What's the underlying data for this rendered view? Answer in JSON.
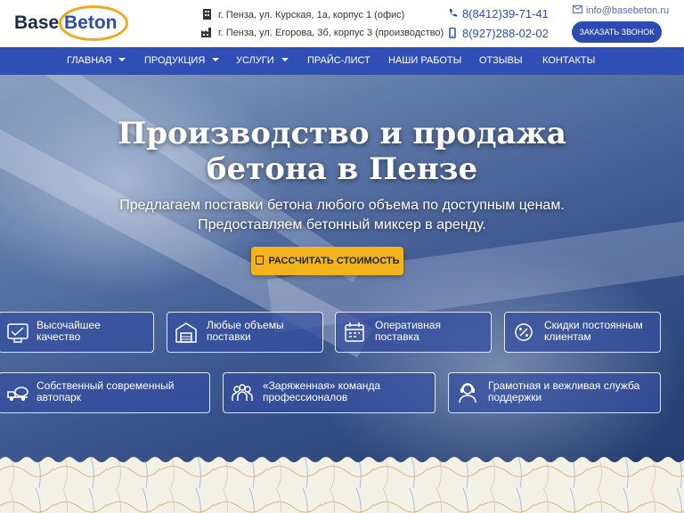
{
  "logo": {
    "part1": "Base",
    "part2": "Beton"
  },
  "header": {
    "address1": "г. Пенза, ул. Курская, 1а, корпус 1 (офис)",
    "address2": "г. Пенза, ул. Егорова, 3б, корпус 3 (производство)",
    "phone1": "8(8412)39-71-41",
    "phone2": "8(927)288-02-02",
    "email": "info@basebeton.ru",
    "call_button": "ЗАКАЗАТЬ ЗВОНОК"
  },
  "nav": {
    "items": [
      {
        "label": "ГЛАВНАЯ",
        "dropdown": true
      },
      {
        "label": "ПРОДУКЦИЯ",
        "dropdown": true
      },
      {
        "label": "УСЛУГИ",
        "dropdown": true
      },
      {
        "label": "ПРАЙС-ЛИСТ",
        "dropdown": false
      },
      {
        "label": "НАШИ РАБОТЫ",
        "dropdown": false
      },
      {
        "label": "ОТЗЫВЫ",
        "dropdown": false
      },
      {
        "label": "КОНТАКТЫ",
        "dropdown": false
      }
    ]
  },
  "hero": {
    "title_line1": "Производство и продажа",
    "title_line2": "бетона в Пензе",
    "subtitle_line1": "Предлагаем поставки бетона любого объема по доступным ценам.",
    "subtitle_line2": "Предоставляем бетонный миксер в аренду.",
    "cta_label": "РАССЧИТАТЬ СТОИМОСТЬ"
  },
  "features": [
    {
      "line1": "Высочайшее",
      "line2": "качество",
      "icon": "quality-icon"
    },
    {
      "line1": "Любые объемы",
      "line2": "поставки",
      "icon": "warehouse-icon"
    },
    {
      "line1": "Оперативная",
      "line2": "поставка",
      "icon": "calendar-icon"
    },
    {
      "line1": "Скидки постоянным",
      "line2": "клиентам",
      "icon": "discount-icon"
    },
    {
      "line1": "Собственный современный",
      "line2": "автопарк",
      "icon": "mixer-truck-icon"
    },
    {
      "line1": "«Заряженная» команда",
      "line2": "профессионалов",
      "icon": "team-icon"
    },
    {
      "line1": "Грамотная и вежливая служба",
      "line2": "поддержки",
      "icon": "support-icon"
    }
  ],
  "colors": {
    "brand_blue": "#2f4fb6",
    "accent_yellow": "#f3b31d",
    "logo_navy": "#1b2a4a"
  }
}
